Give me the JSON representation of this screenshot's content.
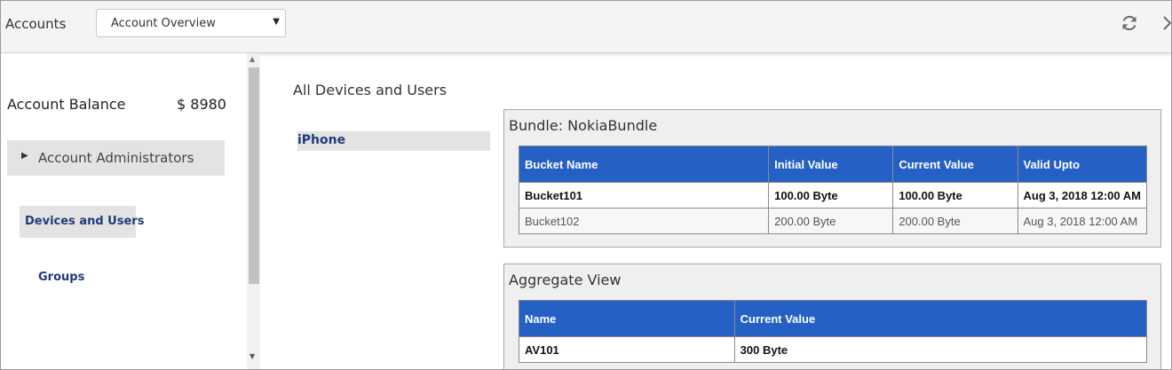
{
  "header": {
    "title": "Accounts",
    "view_select": "Account Overview"
  },
  "sidebar": {
    "balance_label": "Account Balance",
    "balance_value": "$ 8980",
    "admins_label": "Account Administrators",
    "devices_label": "Devices and Users",
    "groups_label": "Groups"
  },
  "main": {
    "section_title": "All Devices and Users",
    "devices": [
      "iPhone"
    ]
  },
  "bundle": {
    "title": "Bundle: NokiaBundle",
    "columns": [
      "Bucket Name",
      "Initial Value",
      "Current Value",
      "Valid Upto"
    ],
    "rows": [
      [
        "Bucket101",
        "100.00 Byte",
        "100.00 Byte",
        "Aug 3, 2018 12:00 AM"
      ],
      [
        "Bucket102",
        "200.00 Byte",
        "200.00 Byte",
        "Aug 3, 2018 12:00 AM"
      ]
    ]
  },
  "aggregate": {
    "title": "Aggregate View",
    "columns": [
      "Name",
      "Current Value"
    ],
    "rows": [
      [
        "AV101",
        "300 Byte"
      ]
    ]
  },
  "icons": {
    "refresh": "refresh-icon",
    "close": "chevron-right-icon",
    "expand": "caret-right-icon",
    "dropdown": "caret-down-icon"
  },
  "colors": {
    "table_header": "#2560c4",
    "nav_text": "#1f3c78",
    "selected_bg": "#e3e3e3"
  }
}
